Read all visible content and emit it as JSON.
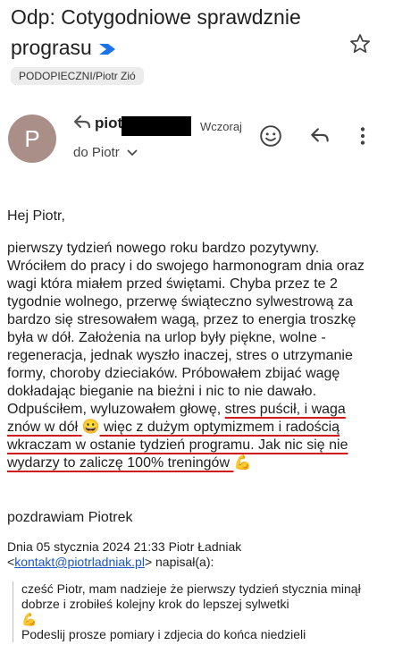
{
  "subject": "Odp: Cotygodniowe sprawdznie prograsu",
  "label": "PODOPIECZNI/Piotr Zió",
  "avatar_letter": "P",
  "sender_name": "piot",
  "date": "Wczoraj",
  "to": "do Piotr",
  "greeting": "Hej Piotr,",
  "paragraph_a": "pierwszy tydzień nowego roku bardzo pozytywny. Wróciłem do pracy i do swojego harmonogram dnia oraz wagi która miałem przed świętami. Chyba przez te 2 tygodnie wolnego, przerwę świąteczno sylwestrową za bardzo się stresowałem wagą, przez to energia troszkę była w dół. Założenia na urlop były piękne, wolne - regeneracja, jednak wyszło inaczej, stres o utrzymanie formy, choroby dzieciaków. Próbowałem zbijać wagę dokładając bieganie na bieżni i nic to nie dawało. Odpuściłem, wyluzowałem głowę, ",
  "paragraph_b": "stres puścił, i waga znów w dół",
  "emoji_smile": "😀",
  "paragraph_c": " więc z dużym optymizmem i radością wkraczam w ostanie tydzień programu.  Jak nic się nie wydarzy to zaliczę 100% treningów",
  "emoji_muscle": "💪",
  "signoff": "pozdrawiam Piotrek",
  "quote_header_a": "Dnia 05 stycznia 2024 21:33 Piotr Ładniak <",
  "quote_email": "kontakt@piotrladniak.pl",
  "quote_header_b": "> napisał(a):",
  "quote_line1": "cześć Piotr, mam nadzieje że pierwszy tydzień stycznia minął dobrze i zrobiłeś kolejny krok do lepszej sylwetki",
  "quote_emoji": "💪",
  "quote_line2": "Podeslij prosze pomiary i zdjecia do końca niedzieli",
  "colors": {
    "link": "#1a56c7",
    "underline": "#d11b1b",
    "avatar": "#a98f87",
    "important": "#1a73e8"
  }
}
